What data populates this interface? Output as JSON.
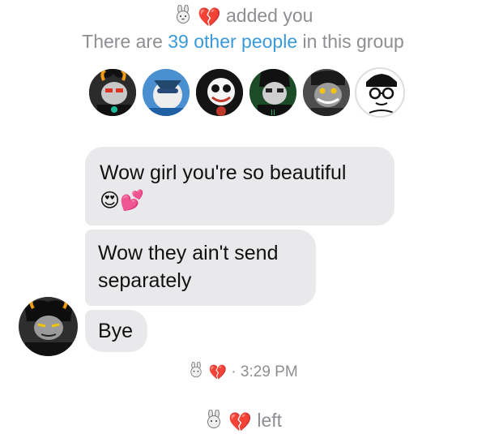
{
  "header": {
    "added_text": "added you",
    "group_prefix": "There are",
    "group_count": "39 other people",
    "group_suffix": "in this group"
  },
  "avatars": [
    {
      "name": "avatar-1"
    },
    {
      "name": "avatar-2"
    },
    {
      "name": "avatar-3"
    },
    {
      "name": "avatar-4"
    },
    {
      "name": "avatar-5"
    },
    {
      "name": "avatar-6"
    }
  ],
  "messages": [
    {
      "text": "Wow girl you're so beautiful",
      "emoji": "😍💕"
    },
    {
      "text": "Wow they ain't send separately"
    },
    {
      "text": "Bye"
    }
  ],
  "footer": {
    "time": "3:29 PM",
    "left_text": "left"
  },
  "icons": {
    "bunny": "bunny-icon",
    "broken_heart": "broken-heart-icon"
  },
  "colors": {
    "bubble": "#e9e9eb",
    "link": "#3a9ad9",
    "meta_text": "#8e8e93"
  }
}
